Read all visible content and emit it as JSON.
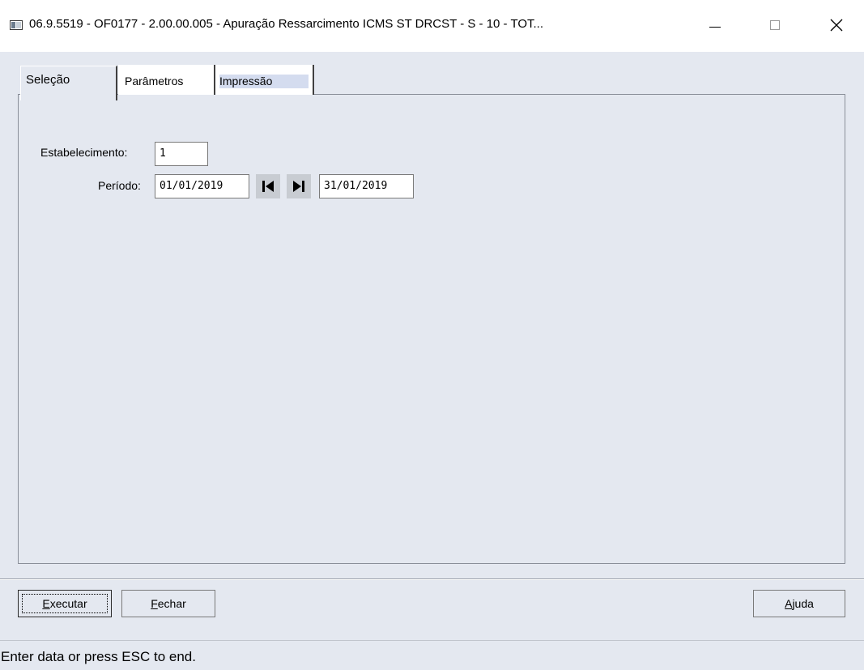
{
  "window": {
    "title": "06.9.5519 - OF0177 - 2.00.00.005 - Apuração Ressarcimento ICMS ST DRCST - S - 10 - TOT..."
  },
  "tabs": [
    {
      "label": "Seleção",
      "selected": true
    },
    {
      "label": "Parâmetros",
      "selected": false
    },
    {
      "label": "Impressão",
      "selected": false
    }
  ],
  "form": {
    "estabelecimento_label": "Estabelecimento:",
    "estabelecimento_value": "1",
    "periodo_label": "Período:",
    "periodo_inicio": "01/01/2019",
    "periodo_fim": "31/01/2019"
  },
  "buttons": {
    "executar": {
      "first": "E",
      "rest": "xecutar"
    },
    "fechar": {
      "first": "F",
      "rest": "echar"
    },
    "ajuda": {
      "first": "A",
      "rest": "juda"
    }
  },
  "status": {
    "message": "Enter data or press ESC to end."
  }
}
